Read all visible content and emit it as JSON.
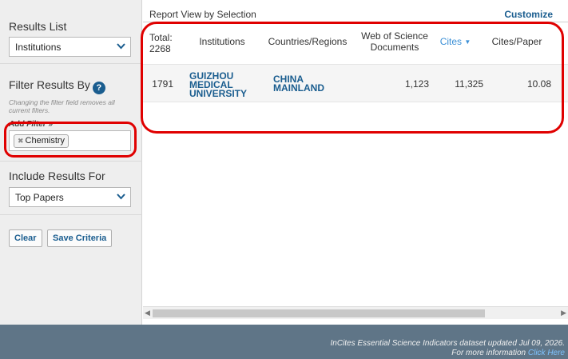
{
  "sidebar": {
    "results_list": {
      "title": "Results List",
      "selected": "Institutions"
    },
    "filter": {
      "title": "Filter Results By",
      "note": "Changing the filter field removes all current filters.",
      "add_filter_label": "Add Filter »",
      "chip": "Chemistry"
    },
    "include": {
      "title": "Include Results For",
      "selected": "Top Papers"
    },
    "buttons": {
      "clear": "Clear",
      "save": "Save Criteria"
    }
  },
  "main": {
    "title": "Report View by Selection",
    "customize": "Customize",
    "columns": {
      "total_label": "Total:",
      "total_value": "2268",
      "institutions": "Institutions",
      "countries": "Countries/Regions",
      "wos_docs": "Web of Science Documents",
      "cites": "Cites",
      "cites_per_paper": "Cites/Paper"
    },
    "rows": [
      {
        "rank": "1791",
        "institution": "GUIZHOU MEDICAL UNIVERSITY",
        "country": "CHINA MAINLAND",
        "wos_docs": "1,123",
        "cites": "11,325",
        "cites_per_paper": "10.08"
      }
    ]
  },
  "footer": {
    "line1": "InCites Essential Science Indicators dataset updated Jul 09, 2026.",
    "line2_prefix": "For more information",
    "line2_link": "Click Here"
  },
  "colors": {
    "accent": "#1a5d8f",
    "sort": "#3a8fd6",
    "highlight": "#e00000",
    "footer": "#5f7587"
  }
}
